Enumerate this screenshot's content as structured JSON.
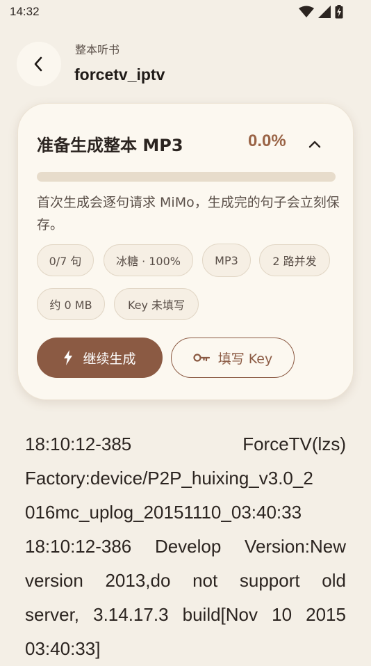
{
  "status_bar": {
    "time": "14:32"
  },
  "header": {
    "subtitle": "整本听书",
    "title": "forcetv_iptv"
  },
  "card": {
    "title": "准备生成整本 MP3",
    "percent": "0.0%",
    "progress_fraction": 0.0,
    "description": "首次生成会逐句请求 MiMo，生成完的句子会立刻保存。",
    "chips": [
      "0/7 句",
      "冰糖 · 100%",
      "MP3",
      "2 路并发",
      "约 0 MB",
      "Key 未填写"
    ],
    "primary_button": "继续生成",
    "secondary_button": "填写 Key"
  },
  "log": {
    "lines": [
      [
        "18:10:12-385",
        "ForceTV(lzs)"
      ],
      [
        "Factory:device/P2P_huixing_v3.0_2"
      ],
      [
        "016mc_uplog_20151110_03:40:33"
      ],
      [
        "18:10:12-386",
        "Develop",
        "Version:New"
      ],
      [
        "version",
        "2013,do",
        "not",
        "support",
        "old"
      ],
      [
        "server,",
        "3.14.17.3",
        "build[Nov",
        "10",
        "2015"
      ],
      [
        "03:40:33]"
      ]
    ]
  },
  "colors": {
    "accent": "#8b5a43",
    "background": "#f4efe6",
    "card": "#fcf8f0"
  }
}
